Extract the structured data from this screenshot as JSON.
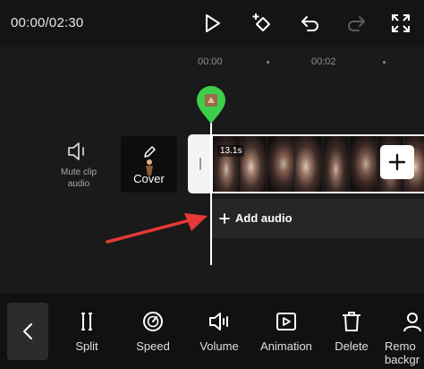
{
  "header": {
    "timecode": "00:00/02:30",
    "icons": [
      "play-icon",
      "keyframe-add-icon",
      "undo-icon",
      "redo-icon",
      "fullscreen-icon"
    ]
  },
  "ruler": {
    "labels": [
      "00:00",
      "00:02"
    ]
  },
  "timeline": {
    "mute_label_line1": "Mute clip",
    "mute_label_line2": "audio",
    "cover_label": "Cover",
    "clip_duration": "13.1s",
    "add_audio_label": "Add audio",
    "accent_color": "#3ecf4a",
    "annotation_arrow_color": "#e53935"
  },
  "toolbar": {
    "items": [
      {
        "label": "Split",
        "icon": "split-icon"
      },
      {
        "label": "Speed",
        "icon": "speed-icon"
      },
      {
        "label": "Volume",
        "icon": "volume-icon"
      },
      {
        "label": "Animation",
        "icon": "animation-icon"
      },
      {
        "label": "Delete",
        "icon": "delete-icon"
      },
      {
        "label": "Remo",
        "label_line2": "backgr",
        "icon": "remove-background-icon"
      }
    ]
  }
}
